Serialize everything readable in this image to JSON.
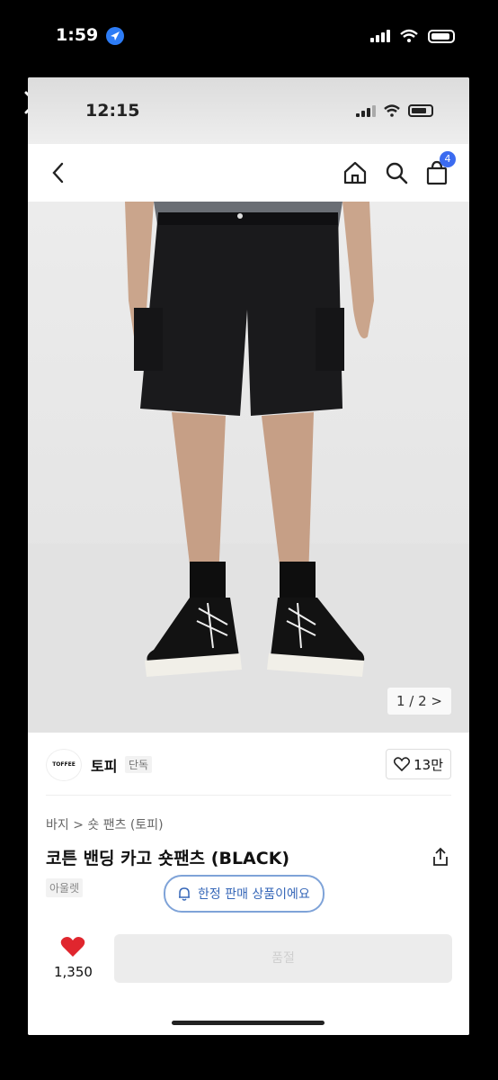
{
  "outer_status": {
    "time": "1:59",
    "wifi": "wifi-icon",
    "battery": "battery-icon"
  },
  "close_icon": "close-icon",
  "inner_status": {
    "time": "12:15"
  },
  "nav": {
    "back": "back-arrow-icon",
    "home": "home-icon",
    "search": "search-icon",
    "bag": "shopping-bag-icon",
    "bag_count": "4"
  },
  "gallery": {
    "counter": "1 / 2 >"
  },
  "brand": {
    "logo_text": "TOFFEE",
    "name": "토피",
    "tag": "단독",
    "likes": "13만"
  },
  "product": {
    "breadcrumb": "바지 > 숏 팬츠 (토피)",
    "title": "코튼 밴딩 카고 숏팬츠 (BLACK)",
    "outlet_tag": "아울렛",
    "limited_notice": "한정 판매 상품이에요"
  },
  "bottom_bar": {
    "likes_count": "1,350",
    "buy_label": "품절"
  },
  "colors": {
    "accent": "#3b6bf0",
    "heart": "#e0262e",
    "notice_border": "#7fa3d8"
  }
}
